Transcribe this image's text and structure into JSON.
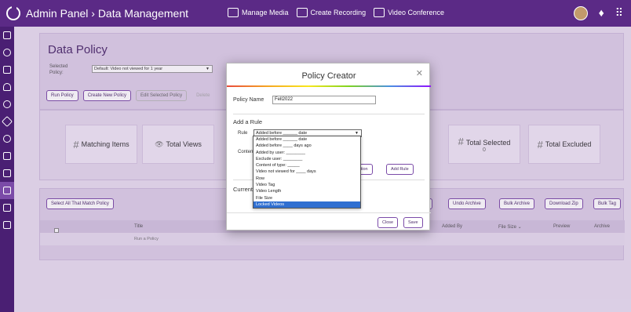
{
  "app": {
    "breadcrumb": "Admin Panel › Data Management",
    "nav": [
      {
        "label": "Manage Media",
        "icon": "film-icon"
      },
      {
        "label": "Create Recording",
        "icon": "recording-icon"
      },
      {
        "label": "Video Conference",
        "icon": "conference-icon"
      }
    ]
  },
  "sidebar": [
    "dashboard-icon",
    "search-icon",
    "monitor-icon",
    "people-icon",
    "key-icon",
    "layers-icon",
    "palette-icon",
    "mail-icon",
    "inbox-icon",
    "data-icon",
    "analytics-icon",
    "building-icon"
  ],
  "page": {
    "title": "Data Policy",
    "selected_policy_label": "Selected Policy:",
    "selected_policy_value": "Default: Video not viewed for 1 year",
    "buttons": [
      "Run Policy",
      "Create New Policy",
      "Edit Selected Policy",
      "Delete"
    ]
  },
  "stats": {
    "matching": "Matching Items",
    "total_views": "Total Views",
    "total_selected": "Total Selected",
    "total_selected_value": "0",
    "total_excluded": "Total Excluded"
  },
  "table": {
    "select_all": "Select All That Match Policy",
    "toolbar_right": [
      "ble",
      "Undo Archive",
      "Bulk Archive",
      "Download Zip",
      "Bulk Tag"
    ],
    "columns": [
      "Title",
      "Added By",
      "File Size ⌄",
      "Preview",
      "Archive"
    ],
    "empty_row": "Run a Policy"
  },
  "modal": {
    "title": "Policy Creator",
    "policy_name_label": "Policy Name",
    "policy_name_value": "Fell2022",
    "add_rule_heading": "Add a Rule",
    "rule_label": "Rule",
    "rule_value": "Added before ______ date",
    "content_label": "Content",
    "current_label": "Current",
    "action_partial": "ction",
    "add_rule_btn": "Add Rule",
    "close_btn": "Close",
    "save_btn": "Save",
    "rule_options": [
      "Added before ______ date",
      "Added before ____ days ago",
      "Added by user: ________",
      "Exclude user: ________",
      "Content of type: _____",
      "Video not viewed for ____ days",
      "Row",
      "Video Tag",
      "Video Length",
      "File Size",
      "Locked Videos"
    ],
    "selected_option_index": 10
  }
}
